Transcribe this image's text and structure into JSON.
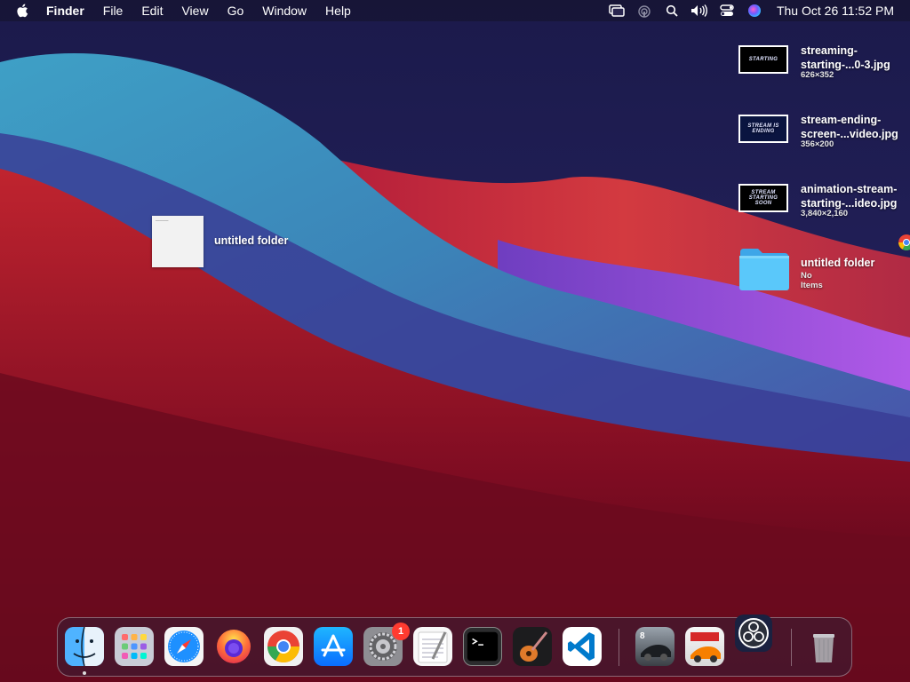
{
  "menubar": {
    "app_name": "Finder",
    "menus": [
      "File",
      "Edit",
      "View",
      "Go",
      "Window",
      "Help"
    ],
    "status_icons": [
      "screen-mirroring-icon",
      "airdrop-icon",
      "search-icon",
      "volume-icon",
      "control-center-icon",
      "siri-icon"
    ],
    "clock": "Thu Oct 26  11:52 PM"
  },
  "desktop": {
    "files": [
      {
        "name_line1": "streaming-",
        "name_line2": "starting-...0-3.jpg",
        "meta": "626×352",
        "thumb_text": "STARTING"
      },
      {
        "name_line1": "stream-ending-",
        "name_line2": "screen-...video.jpg",
        "meta": "356×200",
        "thumb_text": "STREAM IS ENDING"
      },
      {
        "name_line1": "animation-stream-",
        "name_line2": "starting-...ideo.jpg",
        "meta": "3,840×2,160",
        "thumb_text": "STREAM STARTING SOON"
      },
      {
        "name_line1": "untitled folder",
        "name_line2": "",
        "meta": "No Items",
        "thumb_text": ""
      }
    ],
    "dragging_item": {
      "label": "untitled folder"
    }
  },
  "dock": {
    "apps": [
      "Finder",
      "Launchpad",
      "Safari",
      "Firefox",
      "Google Chrome",
      "App Store",
      "System Preferences",
      "TextEdit",
      "Terminal",
      "GarageBand",
      "Visual Studio Code",
      "Asphalt 8",
      "Asphalt 9",
      "OBS",
      "Trash"
    ],
    "system_preferences_badge": "1"
  },
  "colors": {
    "folder_blue": "#5ac8fa",
    "badge_red": "#ff3b30"
  }
}
